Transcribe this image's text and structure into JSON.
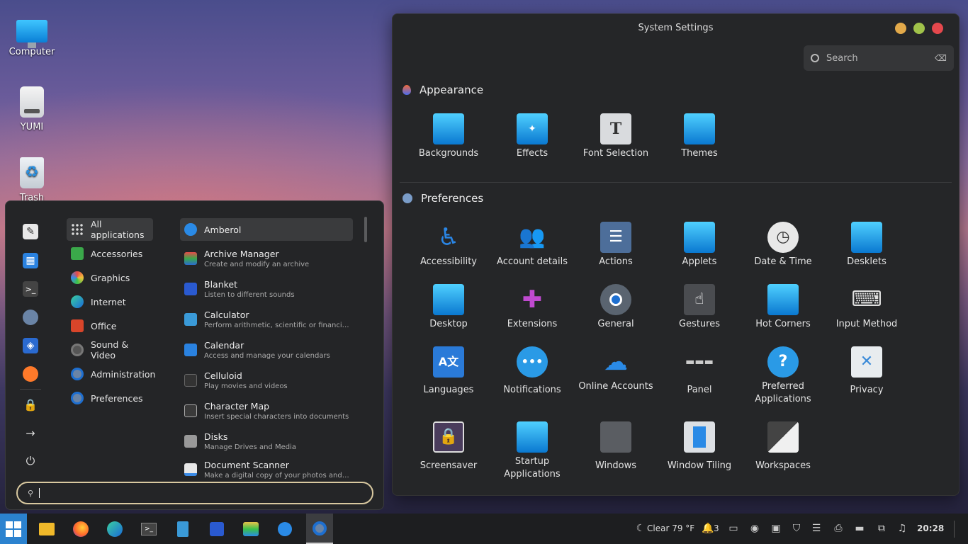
{
  "desktop": {
    "icons": [
      {
        "label": "Computer",
        "icon": "monitor-icon"
      },
      {
        "label": "YUMI",
        "icon": "drive-icon"
      },
      {
        "label": "Trash",
        "icon": "trash-icon"
      }
    ]
  },
  "settings": {
    "title": "System Settings",
    "search_placeholder": "Search",
    "appearance": {
      "heading": "Appearance",
      "items": [
        "Backgrounds",
        "Effects",
        "Font Selection",
        "Themes"
      ]
    },
    "preferences": {
      "heading": "Preferences",
      "items": [
        "Accessibility",
        "Account details",
        "Actions",
        "Applets",
        "Date & Time",
        "Desklets",
        "Desktop",
        "Extensions",
        "General",
        "Gestures",
        "Hot Corners",
        "Input Method",
        "Languages",
        "Notifications",
        "Online Accounts",
        "Panel",
        "Preferred Applications",
        "Privacy",
        "Screensaver",
        "Startup Applications",
        "Windows",
        "Window Tiling",
        "Workspaces"
      ]
    },
    "colors": {
      "close": "#e5484d",
      "maximize": "#a0c24a",
      "minimize": "#e2a94a"
    }
  },
  "menu": {
    "categories": [
      "All applications",
      "Accessories",
      "Graphics",
      "Internet",
      "Office",
      "Sound & Video",
      "Administration",
      "Preferences"
    ],
    "apps": [
      {
        "name": "Amberol",
        "desc": ""
      },
      {
        "name": "Archive Manager",
        "desc": "Create and modify an archive"
      },
      {
        "name": "Blanket",
        "desc": "Listen to different sounds"
      },
      {
        "name": "Calculator",
        "desc": "Perform arithmetic, scientific or financial ca..."
      },
      {
        "name": "Calendar",
        "desc": "Access and manage your calendars"
      },
      {
        "name": "Celluloid",
        "desc": "Play movies and videos"
      },
      {
        "name": "Character Map",
        "desc": "Insert special characters into documents"
      },
      {
        "name": "Disks",
        "desc": "Manage Drives and Media"
      },
      {
        "name": "Document Scanner",
        "desc": "Make a digital copy of your photos and docu..."
      }
    ],
    "search_value": ""
  },
  "taskbar": {
    "weather": "Clear 79 °F",
    "notifications_count": "3",
    "clock": "20:28"
  }
}
